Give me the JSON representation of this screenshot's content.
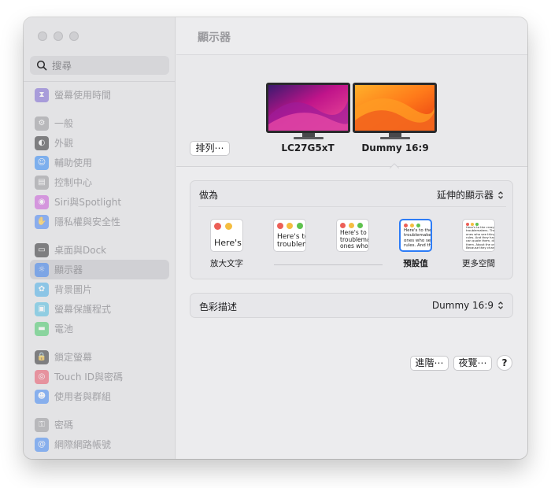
{
  "window": {
    "title": "顯示器",
    "traffic_lights": [
      "close",
      "minimize",
      "zoom"
    ]
  },
  "sidebar": {
    "search_placeholder": "搜尋",
    "items": [
      {
        "label": "螢幕使用時間",
        "icon": "hourglass-icon",
        "color": "#6e56cf"
      },
      {
        "label": "一般",
        "icon": "gear-icon",
        "color": "#8e8e93"
      },
      {
        "label": "外觀",
        "icon": "appearance-icon",
        "color": "#1c1c1e"
      },
      {
        "label": "輔助使用",
        "icon": "accessibility-icon",
        "color": "#1a7cf5"
      },
      {
        "label": "控制中心",
        "icon": "control-center-icon",
        "color": "#8e8e93"
      },
      {
        "label": "Siri與Spotlight",
        "icon": "siri-icon",
        "color": "#c64bd6"
      },
      {
        "label": "隱私權與安全性",
        "icon": "hand-icon",
        "color": "#3478f6"
      },
      {
        "label": "桌面與Dock",
        "icon": "dock-icon",
        "color": "#1c1c1e"
      },
      {
        "label": "顯示器",
        "icon": "sun-icon",
        "color": "#2d7cf6",
        "selected": true
      },
      {
        "label": "背景圖片",
        "icon": "flower-icon",
        "color": "#37a9e8"
      },
      {
        "label": "螢幕保護程式",
        "icon": "screensaver-icon",
        "color": "#40b8e0"
      },
      {
        "label": "電池",
        "icon": "battery-icon",
        "color": "#34c759"
      },
      {
        "label": "鎖定螢幕",
        "icon": "lock-icon",
        "color": "#1c1c1e"
      },
      {
        "label": "Touch ID與密碼",
        "icon": "fingerprint-icon",
        "color": "#e9445a"
      },
      {
        "label": "使用者與群組",
        "icon": "users-icon",
        "color": "#2d7cf6"
      },
      {
        "label": "密碼",
        "icon": "key-icon",
        "color": "#8e8e93"
      },
      {
        "label": "網際網路帳號",
        "icon": "at-icon",
        "color": "#2d7cf6"
      }
    ]
  },
  "displays": {
    "arrange_label": "排列⋯",
    "monitors": [
      {
        "name": "LC27G5xT",
        "wallpaper": "purple"
      },
      {
        "name": "Dummy 16:9",
        "wallpaper": "orange",
        "selected": true
      }
    ]
  },
  "use_as": {
    "label": "做為",
    "value": "延伸的顯示器"
  },
  "resolution": {
    "options": [
      {
        "label": "放大文字",
        "preview": "Here's"
      },
      {
        "label": "",
        "preview": "Here's to\ntroublem"
      },
      {
        "label": "",
        "preview": "Here's to th\ntroublema\nones who s"
      },
      {
        "label": "預設值",
        "preview": "Here's to the c\ntroublemakers.\nones who see th\nrules. And they",
        "selected": true
      },
      {
        "label": "更多空間",
        "preview": "Here's to the crazy one\ntroublemakers. The ro\nones who see things d\nrules. And they have n\ncan quote them, dis\nthem. About the only th\nBecause they change"
      }
    ]
  },
  "color_profile": {
    "label": "色彩描述",
    "value": "Dummy 16:9"
  },
  "buttons": {
    "advanced": "進階⋯",
    "night_shift": "夜覽⋯",
    "help": "?"
  },
  "colors": {
    "accent": "#2d7cf6",
    "close": "#ec5f57",
    "minimize": "#f4bd40",
    "zoom": "#5fc24f"
  }
}
